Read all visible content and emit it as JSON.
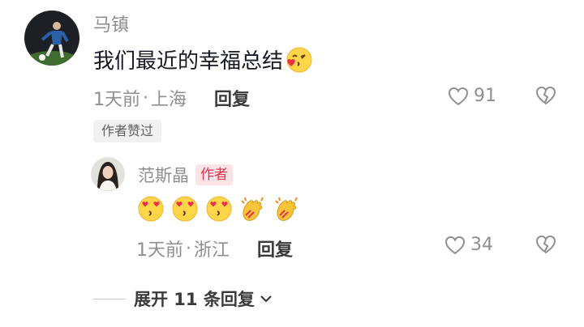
{
  "comment": {
    "username": "马镇",
    "text": "我们最近的幸福总结",
    "time": "1天前",
    "location": "上海",
    "reply_label": "回复",
    "like_count": "91",
    "author_liked_badge": "作者赞过"
  },
  "reply": {
    "username": "范斯晶",
    "author_badge": "作者",
    "emojis": [
      "heart-eyes-kiss-emoji",
      "heart-eyes-kiss-emoji",
      "heart-eyes-kiss-emoji",
      "clapping-hands-emoji",
      "clapping-hands-emoji"
    ],
    "time": "1天前",
    "location": "浙江",
    "reply_label": "回复",
    "like_count": "34"
  },
  "expand": {
    "label": "展开 11 条回复"
  },
  "meta_separator": "·",
  "colors": {
    "secondary_text": "#8e8e93",
    "primary_text": "#161823",
    "author_badge_text": "#e0314d",
    "author_badge_bg": "#fde3e6"
  }
}
